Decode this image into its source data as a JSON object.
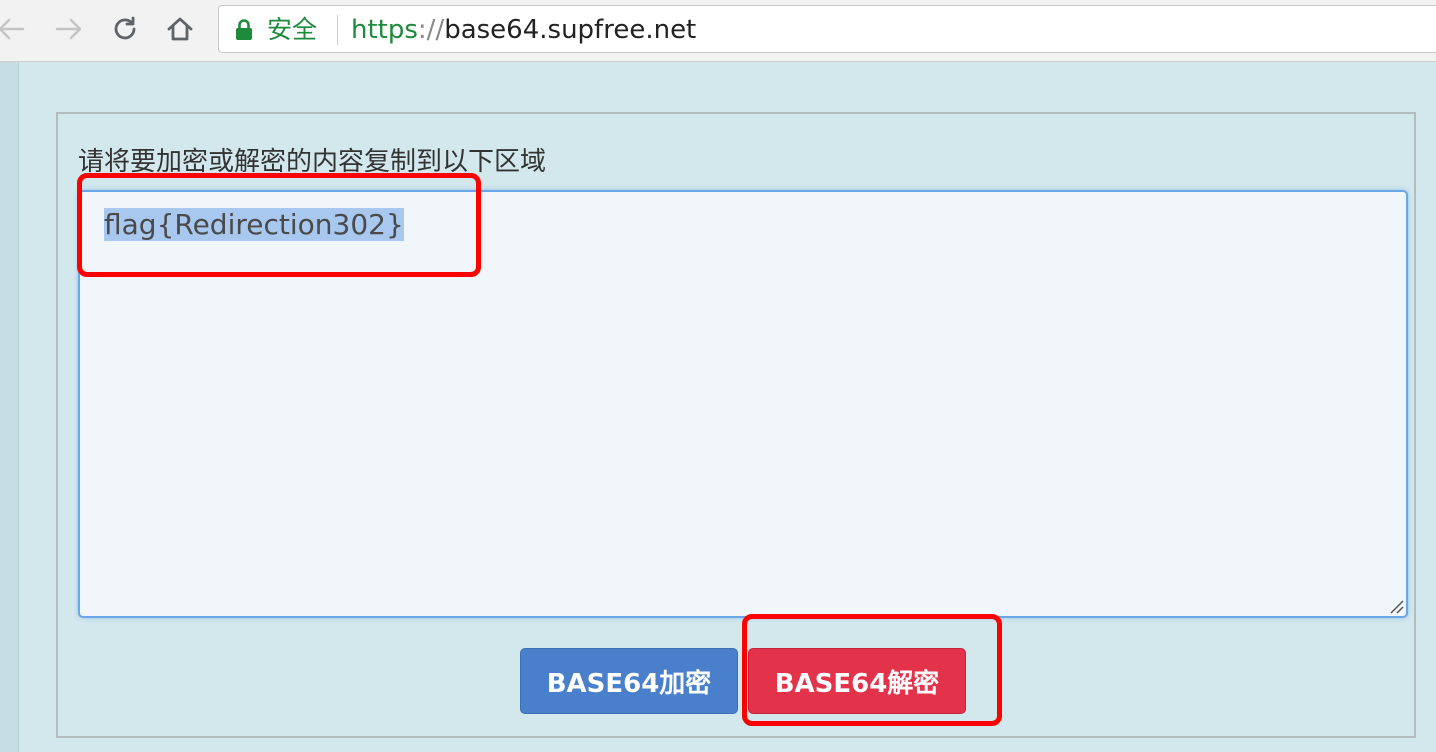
{
  "browser": {
    "secure_label": "安全",
    "url_scheme": "https",
    "url_sep": "://",
    "url_host": "base64.supfree.net"
  },
  "main": {
    "instruction": "请将要加密或解密的内容复制到以下区域",
    "textarea_value": "flag{Redirection302}",
    "encode_button_label": "BASE64加密",
    "decode_button_label": "BASE64解密"
  },
  "colors": {
    "page_background": "#d3e8ed",
    "encode_button": "#4a7fcb",
    "decode_button": "#e2334a",
    "annotation_highlight": "#ff0000",
    "secure_green": "#1e8a3c"
  },
  "icons": {
    "back": "arrow-left-icon",
    "forward": "arrow-right-icon",
    "reload": "reload-icon",
    "home": "home-icon",
    "lock": "lock-icon",
    "resize": "resize-handle-icon"
  }
}
